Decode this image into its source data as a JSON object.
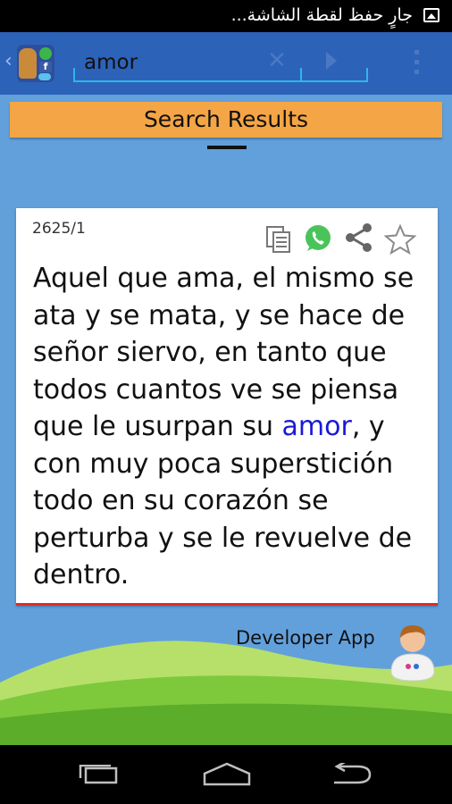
{
  "status_bar": {
    "notification_text": "جارٍ حفظ لقطة الشاشة...",
    "icon": "gallery-icon"
  },
  "action_bar": {
    "back_icon": "chevron-left-icon",
    "app_icon": "app-logo-icon",
    "search": {
      "value": "amor",
      "placeholder": ""
    },
    "clear_icon": "close-icon",
    "go_icon": "play-arrow-icon",
    "menu_icon": "overflow-menu-icon"
  },
  "results_header": "Search Results",
  "result_card": {
    "id": "2625/1",
    "actions": [
      "copy-icon",
      "whatsapp-icon",
      "share-icon",
      "star-icon"
    ],
    "text_before": "Aquel que ama, el mismo se ata y se mata, y se hace de señor siervo, en tanto que todos cuantos ve se piensa que le usurpan su ",
    "keyword": "amor",
    "text_after": ", y con muy poca superstición todo en su corazón se perturba y se le revuelve de dentro."
  },
  "developer": {
    "label": "Developer App",
    "icon": "avatar-icon"
  },
  "nav_bar": {
    "icons": [
      "recent-apps-icon",
      "home-icon",
      "back-icon"
    ]
  },
  "colors": {
    "action_bar": "#2c63b9",
    "background": "#62a0dc",
    "results_header": "#f4a545",
    "keyword": "#1a1ad6",
    "card_underline": "#e02a2a",
    "input_underline": "#2fb6ea"
  }
}
